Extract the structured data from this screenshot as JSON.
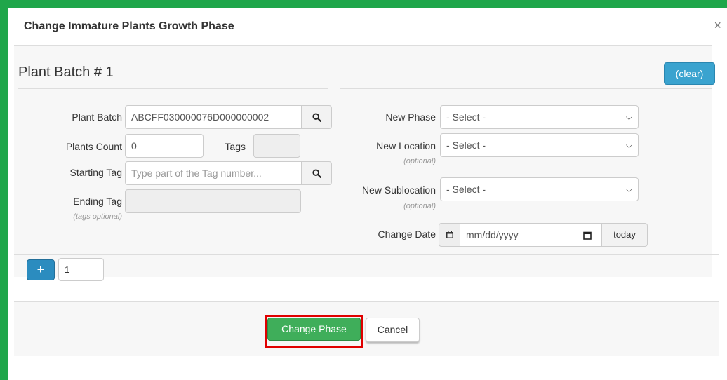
{
  "dialog": {
    "title": "Change Immature Plants Growth Phase",
    "close_label": "×"
  },
  "batch": {
    "title": "Plant Batch # 1",
    "clear_label": "(clear)"
  },
  "left_form": {
    "plant_batch_label": "Plant Batch",
    "plant_batch_value": "ABCFF030000076D000000002",
    "plants_count_label": "Plants Count",
    "plants_count_value": "0",
    "tags_label": "Tags",
    "tags_value": "",
    "starting_tag_label": "Starting Tag",
    "starting_tag_placeholder": "Type part of the Tag number...",
    "ending_tag_label": "Ending Tag",
    "ending_tag_note": "(tags optional)",
    "ending_tag_value": ""
  },
  "right_form": {
    "new_phase_label": "New Phase",
    "new_phase_value": "- Select -",
    "new_location_label": "New Location",
    "new_location_note": "(optional)",
    "new_location_value": "- Select -",
    "new_sublocation_label": "New Sublocation",
    "new_sublocation_note": "(optional)",
    "new_sublocation_value": "- Select -",
    "change_date_label": "Change Date",
    "change_date_placeholder": "mm/dd/yyyy",
    "today_label": "today"
  },
  "add_row": {
    "plus_label": "+",
    "count_value": "1"
  },
  "footer": {
    "change_phase_label": "Change Phase",
    "cancel_label": "Cancel"
  },
  "colors": {
    "frame_green": "#1fa64a",
    "primary_blue": "#2b8cbf",
    "success_green": "#3fae5a",
    "highlight_red": "#e00000"
  }
}
